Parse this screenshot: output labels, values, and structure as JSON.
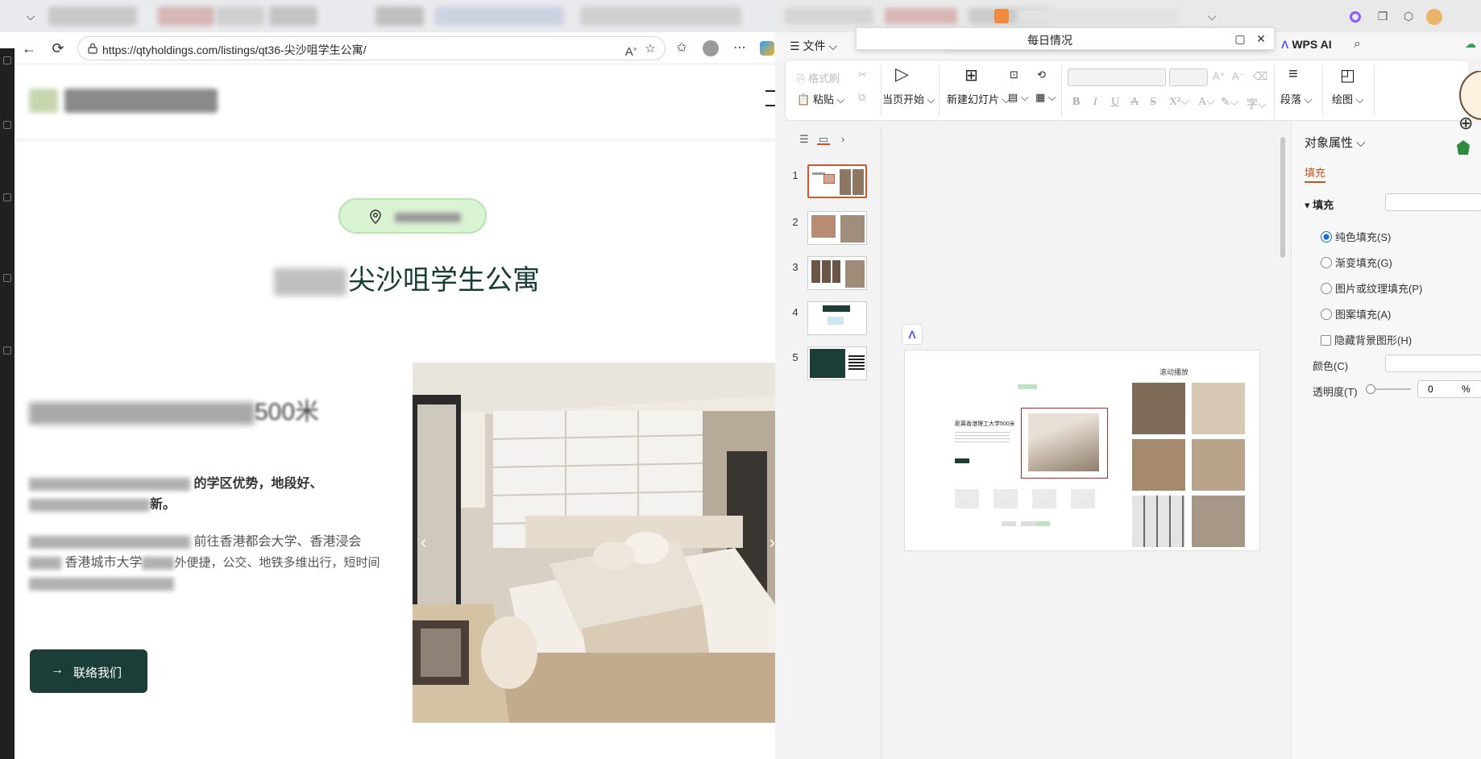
{
  "browser": {
    "url": "https://qtyholdings.com/listings/qt36-尖沙咀学生公寓/",
    "listing_title_suffix": "尖沙咀学生公寓",
    "feature_heading_tail": "500米",
    "para1_visible": "的学区优势，地段好、",
    "para1_line2_tail": "新。",
    "para2_line1": "前往香港都会大学、香港浸会",
    "para2_line2": "香港城市大学",
    "para2_line2_tail": "外便捷，公交、地铁多维出行，短时间",
    "contact_label": "联络我们",
    "contact_arrow": "→"
  },
  "wps": {
    "file_menu": "文件",
    "floating_window_title": "每日情况",
    "ai_label": "WPS AI",
    "ribbon": {
      "format_painter": "格式刷",
      "paste": "粘贴",
      "play_from_current": "当页开始",
      "new_slide": "新建幻灯片",
      "paragraph": "段落",
      "draw": "绘图"
    },
    "thumbnails": [
      "1",
      "2",
      "3",
      "4",
      "5"
    ],
    "slide": {
      "scroll_label": "滚动播放",
      "heading": "距离香港理工大学500米"
    },
    "properties": {
      "title": "对象属性",
      "tab_fill": "填充",
      "section_fill": "填充",
      "solid_fill": "纯色填充(S)",
      "gradient_fill": "渐变填充(G)",
      "picture_fill": "图片或纹理填充(P)",
      "pattern_fill": "图案填充(A)",
      "hide_bg": "隐藏背景图形(H)",
      "color_label": "颜色(C)",
      "transparency_label": "透明度(T)",
      "transparency_value": "0",
      "percent": "%"
    }
  },
  "colors": {
    "brand_dark_green": "#1b3f38",
    "pill_green": "#d9f3d3",
    "wps_accent": "#c5511e"
  }
}
